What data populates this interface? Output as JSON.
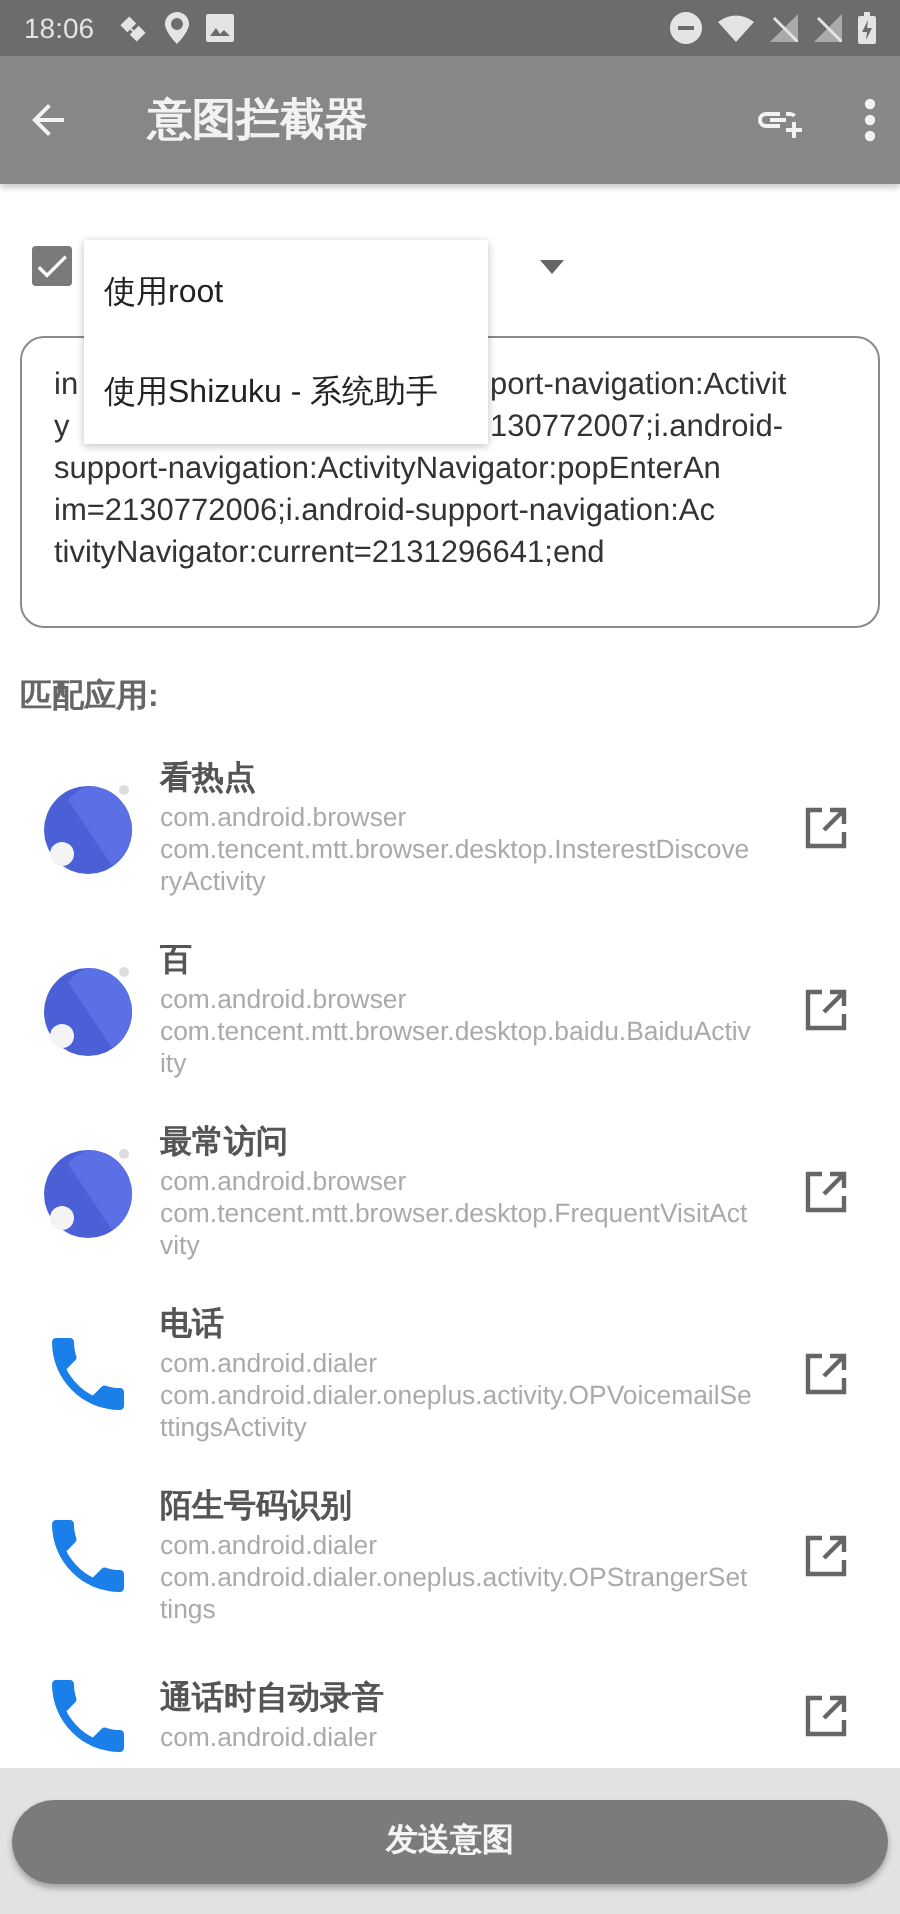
{
  "status_bar": {
    "time": "18:06"
  },
  "toolbar": {
    "title": "意图拦截器"
  },
  "mode": {
    "checked": true,
    "options": [
      {
        "label": "使用root"
      },
      {
        "label": "使用Shizuku - 系统助手"
      }
    ]
  },
  "intent_field": {
    "lines": [
      {
        "left": "in",
        "right": "port-navigation:Activit"
      },
      {
        "left": "y",
        "right": "130772007;i.android-"
      },
      {
        "left": "support-navigation:ActivityNavigator:popEnterAn"
      },
      {
        "left": "im=2130772006;i.android-support-navigation:Ac"
      },
      {
        "left": "tivityNavigator:current=2131296641;end"
      }
    ]
  },
  "matched_label": "匹配应用:",
  "apps": [
    {
      "kind": "browser",
      "title": "看热点",
      "package": "com.android.browser",
      "activity": "com.tencent.mtt.browser.desktop.InsterestDiscoveryActivity"
    },
    {
      "kind": "browser",
      "title": "百",
      "package": "com.android.browser",
      "activity": "com.tencent.mtt.browser.desktop.baidu.BaiduActivity"
    },
    {
      "kind": "browser",
      "title": "最常访问",
      "package": "com.android.browser",
      "activity": "com.tencent.mtt.browser.desktop.FrequentVisitActvity"
    },
    {
      "kind": "phone",
      "title": "电话",
      "package": "com.android.dialer",
      "activity": "com.android.dialer.oneplus.activity.OPVoicemailSettingsActivity"
    },
    {
      "kind": "phone",
      "title": "陌生号码识别",
      "package": "com.android.dialer",
      "activity": "com.android.dialer.oneplus.activity.OPStrangerSettings"
    },
    {
      "kind": "phone",
      "title": "通话时自动录音",
      "package": "com.android.dialer"
    }
  ],
  "send_button": "发送意图"
}
